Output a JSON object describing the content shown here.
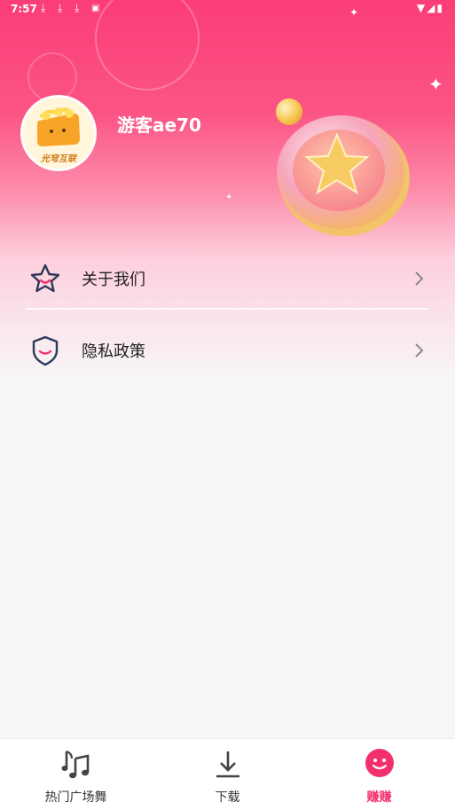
{
  "status_bar": {
    "time": "7:57",
    "icons": [
      "download-icon",
      "download-icon",
      "download-icon",
      "a-icon"
    ],
    "right_icons": [
      "wifi-icon",
      "signal-icon",
      "battery-icon"
    ]
  },
  "profile": {
    "username": "游客ae70",
    "avatar_text": "光穹互联"
  },
  "menu": [
    {
      "label": "关于我们",
      "icon": "star-icon"
    },
    {
      "label": "隐私政策",
      "icon": "shield-icon"
    }
  ],
  "tabbar": {
    "tabs": [
      {
        "label": "热门广场舞",
        "icon": "music-note-icon",
        "active": false
      },
      {
        "label": "下载",
        "icon": "download-icon",
        "active": false
      },
      {
        "label": "赚赚",
        "icon": "smiley-icon",
        "active": true
      }
    ]
  },
  "colors": {
    "brand": "#fb3d77",
    "active_tab": "#f1306c",
    "icon_stroke": "#2c3a5a"
  }
}
